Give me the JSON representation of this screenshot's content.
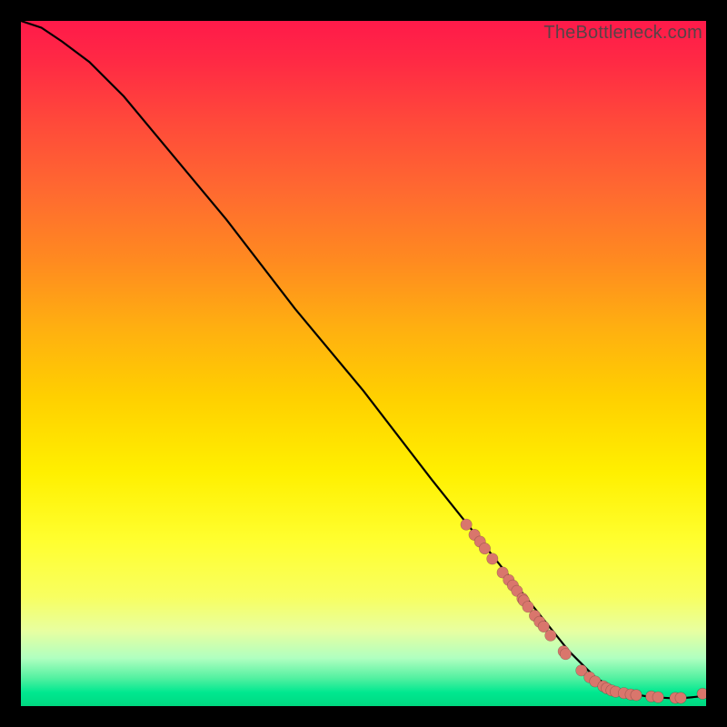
{
  "watermark": "TheBottleneck.com",
  "chart_data": {
    "type": "line",
    "title": "",
    "xlabel": "",
    "ylabel": "",
    "xlim": [
      0,
      100
    ],
    "ylim": [
      0,
      100
    ],
    "grid": false,
    "series": [
      {
        "name": "curve",
        "x": [
          0,
          3,
          6,
          10,
          15,
          20,
          30,
          40,
          50,
          60,
          68,
          72,
          76,
          80,
          84,
          88,
          92,
          96,
          100
        ],
        "y": [
          100,
          99,
          97,
          94,
          89,
          83,
          71,
          58,
          46,
          33,
          23,
          18,
          13,
          8,
          4,
          2,
          1.3,
          1.1,
          1.5
        ]
      }
    ],
    "scatter": {
      "name": "markers",
      "points": [
        {
          "x": 65.0,
          "y": 26.5
        },
        {
          "x": 66.2,
          "y": 25.0
        },
        {
          "x": 67.0,
          "y": 24.0
        },
        {
          "x": 67.7,
          "y": 23.0
        },
        {
          "x": 68.8,
          "y": 21.5
        },
        {
          "x": 70.3,
          "y": 19.5
        },
        {
          "x": 71.2,
          "y": 18.4
        },
        {
          "x": 71.8,
          "y": 17.6
        },
        {
          "x": 72.4,
          "y": 16.8
        },
        {
          "x": 73.2,
          "y": 15.7
        },
        {
          "x": 73.4,
          "y": 15.4
        },
        {
          "x": 74.0,
          "y": 14.5
        },
        {
          "x": 75.0,
          "y": 13.2
        },
        {
          "x": 75.7,
          "y": 12.3
        },
        {
          "x": 76.3,
          "y": 11.6
        },
        {
          "x": 77.3,
          "y": 10.3
        },
        {
          "x": 79.2,
          "y": 8.0
        },
        {
          "x": 79.5,
          "y": 7.6
        },
        {
          "x": 81.8,
          "y": 5.2
        },
        {
          "x": 83.0,
          "y": 4.2
        },
        {
          "x": 83.8,
          "y": 3.6
        },
        {
          "x": 85.0,
          "y": 2.9
        },
        {
          "x": 85.5,
          "y": 2.6
        },
        {
          "x": 86.2,
          "y": 2.3
        },
        {
          "x": 86.8,
          "y": 2.1
        },
        {
          "x": 88.0,
          "y": 1.9
        },
        {
          "x": 89.0,
          "y": 1.7
        },
        {
          "x": 89.8,
          "y": 1.6
        },
        {
          "x": 92.0,
          "y": 1.4
        },
        {
          "x": 93.0,
          "y": 1.3
        },
        {
          "x": 95.5,
          "y": 1.2
        },
        {
          "x": 96.3,
          "y": 1.2
        },
        {
          "x": 99.5,
          "y": 1.8
        }
      ]
    },
    "colors": {
      "curve": "#000000",
      "marker": "#d9766c",
      "gradient_top": "#ff1a4a",
      "gradient_mid": "#fff000",
      "gradient_bottom": "#00d880"
    }
  }
}
